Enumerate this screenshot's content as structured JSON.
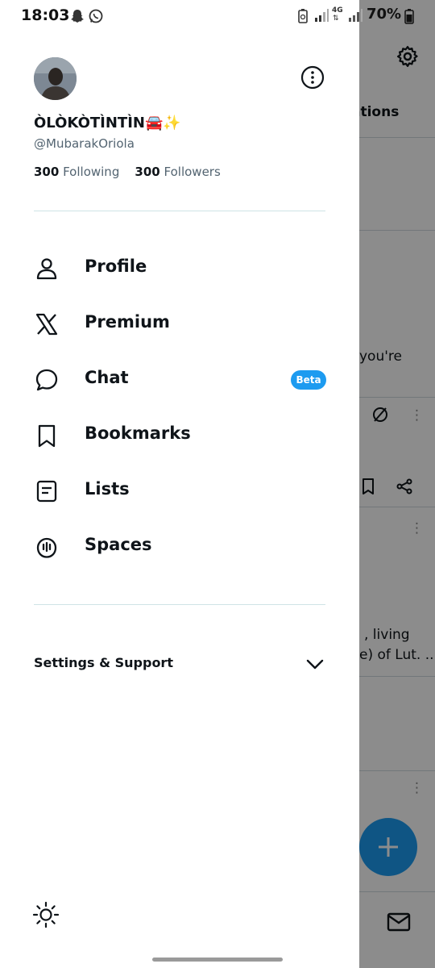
{
  "status_bar": {
    "time": "18:03",
    "network": "4G",
    "battery": "70%"
  },
  "profile": {
    "display_name": "ÒLÒKÒTÌNTÌN🚘✨",
    "handle": "@MubarakOriola",
    "following_count": "300",
    "following_label": "Following",
    "followers_count": "300",
    "followers_label": "Followers"
  },
  "menu": {
    "items": [
      {
        "label": "Profile",
        "icon": "person-icon"
      },
      {
        "label": "Premium",
        "icon": "x-logo-icon"
      },
      {
        "label": "Chat",
        "icon": "chat-bubble-icon",
        "badge": "Beta"
      },
      {
        "label": "Bookmarks",
        "icon": "bookmark-icon"
      },
      {
        "label": "Lists",
        "icon": "list-icon"
      },
      {
        "label": "Spaces",
        "icon": "spaces-icon"
      }
    ]
  },
  "settings": {
    "label": "Settings & Support"
  },
  "background": {
    "tab_text": "ations",
    "text_1": "you're",
    "text_2": ", living",
    "text_3": "e) of Lut. ..."
  },
  "colors": {
    "accent": "#1d9bf0",
    "text_primary": "#0f1419",
    "text_secondary": "#536471",
    "divider": "#cfe3e6"
  }
}
